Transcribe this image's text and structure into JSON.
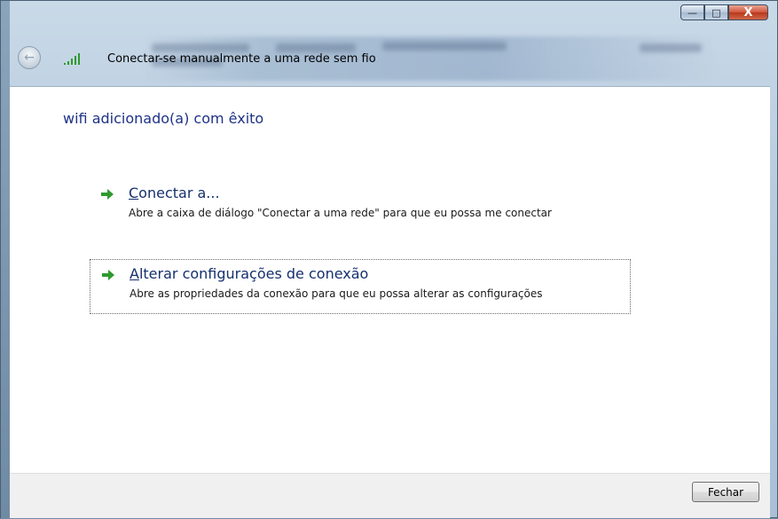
{
  "window": {
    "header_title": "Conectar-se manualmente a uma rede sem fio",
    "caption": {
      "minimize": "—",
      "maximize": "□",
      "close": "X"
    }
  },
  "main": {
    "title": "wifi adicionado(a) com êxito",
    "links": [
      {
        "accel": "C",
        "title_rest": "onectar a...",
        "description": "Abre a caixa de diálogo \"Conectar a uma rede\" para que eu possa me conectar"
      },
      {
        "accel": "A",
        "title_rest": "lterar configurações de conexão",
        "description": "Abre as propriedades da conexão para que eu possa alterar as configurações"
      }
    ]
  },
  "footer": {
    "close_label": "Fechar"
  },
  "icons": {
    "back": "back-arrow-icon",
    "wifi": "wifi-signal-icon",
    "arrow": "green-arrow-icon"
  },
  "colors": {
    "title": "#1e3287",
    "link": "#15306d",
    "arrow": "#2e9a2e"
  }
}
